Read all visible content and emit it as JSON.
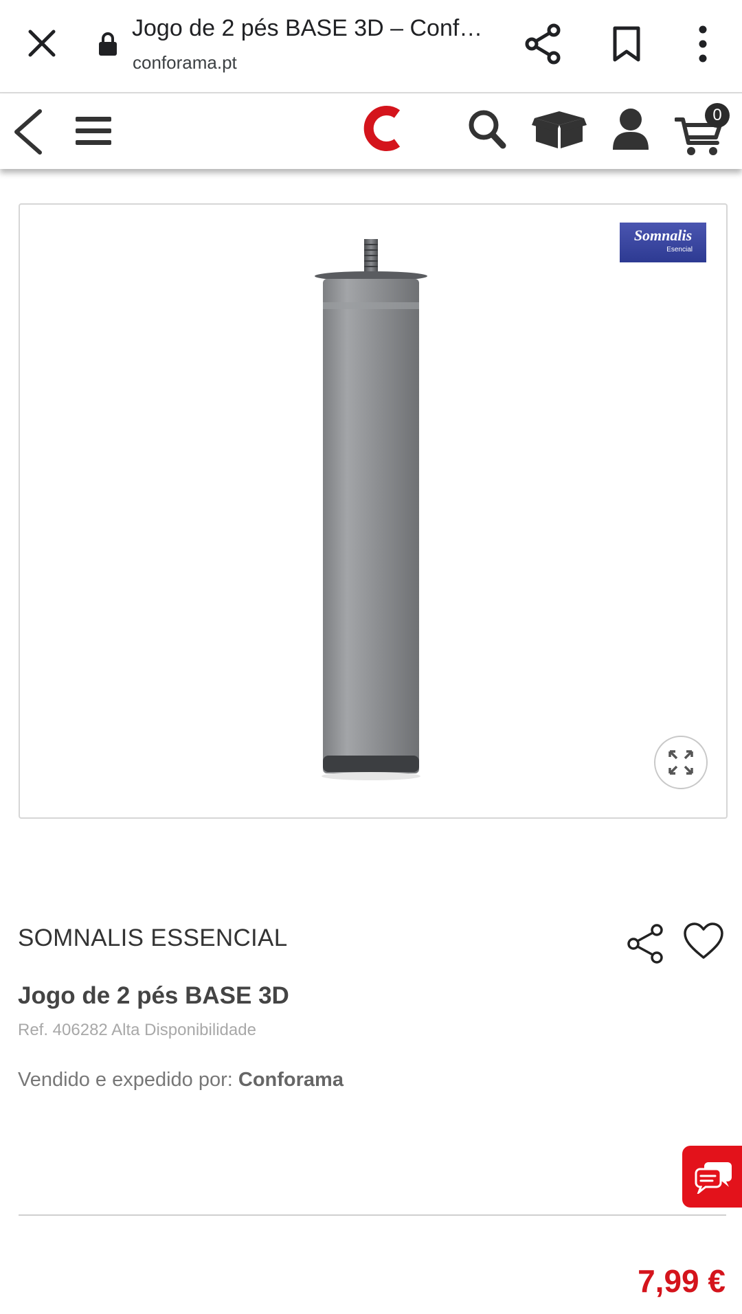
{
  "browser": {
    "title": "Jogo de 2 pés BASE 3D – Conf…",
    "url": "conforama.pt"
  },
  "header": {
    "logo_letter": "C",
    "cart_count": "0"
  },
  "product": {
    "brand_badge_line1": "Somnalis",
    "brand_badge_line2": "Esencial",
    "brand": "SOMNALIS ESSENCIAL",
    "title": "Jogo de 2 pés BASE 3D",
    "ref": "Ref. 406282 Alta Disponibilidade",
    "sold_by_label": "Vendido e expedido por: ",
    "seller": "Conforama",
    "price": "7,99 €"
  },
  "colors": {
    "brand_red": "#d4141c",
    "chat_red": "#e3121b",
    "icon_dark": "#333333"
  }
}
